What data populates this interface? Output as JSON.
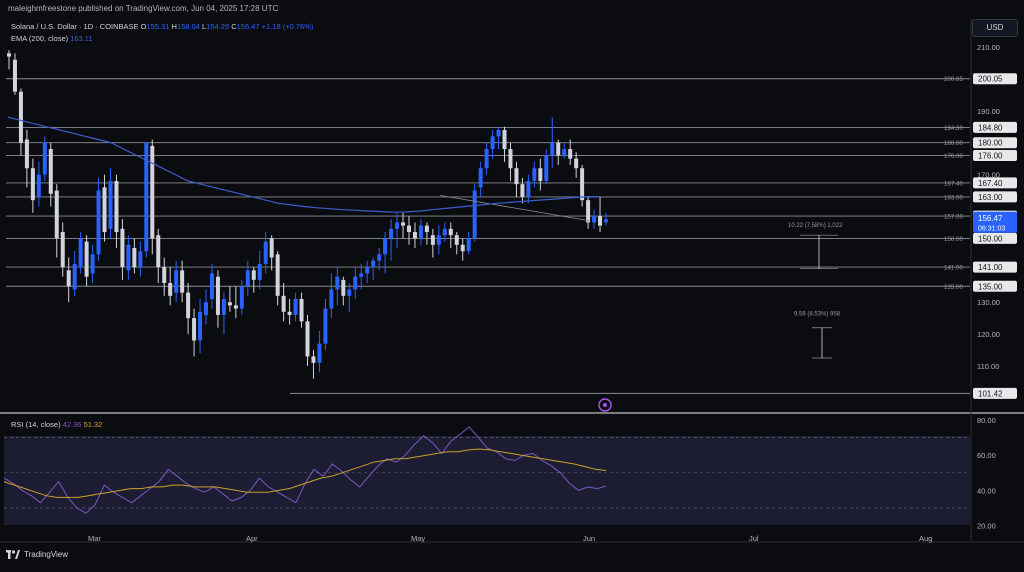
{
  "header": {
    "publisher_text": "maleighmfreestone published on TradingView.com, Jun 04, 2025 17:28 UTC"
  },
  "legend": {
    "symbol_title": "Solana / U.S. Dollar · 1D · COINBASE",
    "ohlc": [
      {
        "key": "O",
        "value": "155.31"
      },
      {
        "key": "H",
        "value": "158.04"
      },
      {
        "key": "L",
        "value": "154.29"
      },
      {
        "key": "C",
        "value": "156.47"
      }
    ],
    "change": "+1.18 (+0.76%)",
    "ema_label": "EMA (200, close)",
    "ema_value": "163.11"
  },
  "currency_button": "USD",
  "price_axis": {
    "ticks": [
      "210.00",
      "190.00",
      "170.00",
      "130.00",
      "120.00",
      "110.00"
    ]
  },
  "levels": [
    {
      "price": 200.05,
      "left_label": "200.05",
      "badge": "200.05"
    },
    {
      "price": 184.8,
      "left_label": "184.80",
      "badge": "184.80"
    },
    {
      "price": 180.0,
      "left_label": "180.00",
      "badge": "180.00"
    },
    {
      "price": 176.0,
      "left_label": "176.00",
      "badge": "176.00"
    },
    {
      "price": 167.4,
      "left_label": "167.40",
      "badge": "167.40"
    },
    {
      "price": 163.0,
      "left_label": "163.00",
      "badge": "163.00"
    },
    {
      "price": 157.0,
      "left_label": "157.00",
      "badge": "157.00"
    },
    {
      "price": 150.0,
      "left_label": "150.00",
      "badge": "150.00"
    },
    {
      "price": 141.0,
      "left_label": "141.00",
      "badge": "141.00"
    },
    {
      "price": 135.0,
      "left_label": "135.00",
      "badge": "135.00"
    },
    {
      "price": 101.42,
      "left_label": "",
      "badge": "101.42"
    }
  ],
  "current_price": {
    "price": 156.47,
    "value": "156.47",
    "countdown": "06:31:03",
    "color": "#2962ff"
  },
  "measurements": [
    {
      "label": "10.22 (7.58%) 1,022"
    },
    {
      "label": "9.58 (8.53%) 958"
    }
  ],
  "rsi": {
    "label": "RSI (14, close)",
    "value": "42.36",
    "ma_value": "51.32",
    "ticks": [
      "80.00",
      "60.00",
      "40.00",
      "20.00"
    ]
  },
  "time_axis": [
    "Mar",
    "Apr",
    "May",
    "Jun",
    "Jul",
    "Aug"
  ],
  "footer_brand": "TradingView",
  "colors": {
    "background": "#0b0c10",
    "up_candle": "#2962ff",
    "down_candle": "#d1d4dc",
    "ema": "#3f5bd1",
    "rsi_line": "#7e57c2",
    "rsi_ma": "#c9a227",
    "level_line": "#8a8d96"
  },
  "chart_data": {
    "type": "candlestick",
    "price_scale": [
      95,
      225
    ],
    "candles": [
      [
        208,
        207,
        209,
        203
      ],
      [
        206,
        196,
        208,
        195
      ],
      [
        196,
        180,
        197,
        176
      ],
      [
        181,
        172,
        184,
        166
      ],
      [
        172,
        162,
        175,
        158
      ],
      [
        163,
        170,
        174,
        160
      ],
      [
        170,
        180,
        182,
        168
      ],
      [
        178,
        164,
        180,
        160
      ],
      [
        165,
        150,
        167,
        144
      ],
      [
        152,
        141,
        155,
        138
      ],
      [
        140,
        135,
        144,
        130
      ],
      [
        134,
        142,
        146,
        132
      ],
      [
        141,
        150,
        152,
        139
      ],
      [
        149,
        138,
        151,
        135
      ],
      [
        139,
        145,
        148,
        136
      ],
      [
        145,
        165,
        169,
        143
      ],
      [
        166,
        152,
        170,
        149
      ],
      [
        153,
        168,
        172,
        150
      ],
      [
        168,
        152,
        170,
        147
      ],
      [
        153,
        141,
        156,
        137
      ],
      [
        140,
        148,
        151,
        137
      ],
      [
        147,
        141,
        150,
        139
      ],
      [
        141,
        146,
        149,
        138
      ],
      [
        146,
        180,
        180,
        144
      ],
      [
        179,
        150,
        181,
        145
      ],
      [
        151,
        141,
        153,
        136
      ],
      [
        141,
        136,
        144,
        132
      ],
      [
        136,
        132,
        141,
        129
      ],
      [
        133,
        140,
        143,
        130
      ],
      [
        140,
        133,
        143,
        130
      ],
      [
        133,
        125,
        136,
        120
      ],
      [
        125,
        118,
        128,
        113
      ],
      [
        118,
        127,
        131,
        114
      ],
      [
        126,
        130,
        134,
        123
      ],
      [
        131,
        139,
        142,
        128
      ],
      [
        138,
        126,
        140,
        122
      ],
      [
        126,
        131,
        133,
        120
      ],
      [
        130,
        129,
        135,
        127
      ],
      [
        129,
        128,
        135,
        125
      ],
      [
        128,
        135,
        137,
        126
      ],
      [
        135,
        140,
        143,
        132
      ],
      [
        140,
        137,
        141,
        133
      ],
      [
        137,
        142,
        146,
        134
      ],
      [
        142,
        149,
        152,
        139
      ],
      [
        150,
        144,
        151,
        140
      ],
      [
        145,
        132,
        146,
        129
      ],
      [
        132,
        127,
        136,
        124
      ],
      [
        127,
        126,
        131,
        123
      ],
      [
        126,
        131,
        133,
        124
      ],
      [
        131,
        124,
        133,
        122
      ],
      [
        124,
        113,
        126,
        110
      ],
      [
        113,
        111,
        115,
        106
      ],
      [
        111,
        117,
        121,
        108
      ],
      [
        117,
        128,
        131,
        115
      ],
      [
        128,
        134,
        139,
        125
      ],
      [
        134,
        138,
        141,
        129
      ],
      [
        137,
        132,
        138,
        129
      ],
      [
        132,
        134,
        136,
        127
      ],
      [
        134,
        138,
        141,
        131
      ],
      [
        138,
        139,
        142,
        134
      ],
      [
        139,
        141,
        143,
        136
      ],
      [
        141,
        143,
        144,
        137
      ],
      [
        143,
        145,
        147,
        140
      ],
      [
        145,
        150,
        152,
        139
      ],
      [
        150,
        153,
        156,
        143
      ],
      [
        153,
        155,
        158,
        147
      ],
      [
        155,
        154,
        158,
        150
      ],
      [
        154,
        152,
        157,
        148
      ],
      [
        152,
        150,
        155,
        147
      ],
      [
        150,
        154,
        156,
        148
      ],
      [
        154,
        152,
        155,
        148
      ],
      [
        151,
        148,
        153,
        144
      ],
      [
        148,
        151,
        154,
        145
      ],
      [
        151,
        153,
        155,
        149
      ],
      [
        153,
        151,
        155,
        147
      ],
      [
        151,
        148,
        152,
        145
      ],
      [
        148,
        146,
        150,
        143
      ],
      [
        146,
        150,
        152,
        145
      ],
      [
        150,
        165,
        167,
        149
      ],
      [
        166,
        172,
        174,
        163
      ],
      [
        172,
        178,
        180,
        170
      ],
      [
        178,
        182,
        184,
        175
      ],
      [
        182,
        184,
        185,
        178
      ],
      [
        184,
        178,
        185,
        174
      ],
      [
        178,
        172,
        180,
        168
      ],
      [
        172,
        167,
        174,
        163
      ],
      [
        167,
        163,
        169,
        161
      ],
      [
        163,
        168,
        170,
        161
      ],
      [
        168,
        172,
        174,
        166
      ],
      [
        172,
        168,
        175,
        165
      ],
      [
        168,
        176,
        178,
        167
      ],
      [
        176,
        180,
        188,
        172
      ],
      [
        180,
        176,
        181,
        173
      ],
      [
        176,
        178,
        180,
        175
      ],
      [
        178,
        175,
        181,
        173
      ],
      [
        175,
        172,
        177,
        169
      ],
      [
        172,
        162,
        173,
        160
      ],
      [
        162,
        155,
        163,
        153
      ],
      [
        155,
        157,
        159,
        153
      ],
      [
        157,
        154,
        163,
        152
      ],
      [
        155,
        156,
        158,
        154
      ]
    ],
    "ema": [
      188,
      187,
      186,
      185,
      184,
      183,
      182,
      181,
      180,
      178,
      176,
      174,
      172,
      170,
      168,
      167,
      166,
      165,
      164,
      163,
      162,
      161,
      160.5,
      160,
      159.6,
      159.3,
      159,
      158.8,
      158.6,
      158.4,
      158.2,
      158.3,
      158.6,
      159,
      159.4,
      159.8,
      160.2,
      160.6,
      161,
      161.3,
      161.6,
      161.9,
      162.2,
      162.5,
      162.8,
      163.1,
      163.11
    ],
    "rsi": [
      47,
      44,
      40,
      37,
      33,
      39,
      45,
      36,
      30,
      27,
      32,
      43,
      39,
      36,
      33,
      37,
      41,
      45,
      52,
      48,
      44,
      41,
      39,
      42,
      38,
      34,
      36,
      40,
      47,
      42,
      39,
      36,
      33,
      44,
      52,
      48,
      55,
      51,
      46,
      42,
      48,
      54,
      58,
      56,
      60,
      66,
      71,
      67,
      61,
      68,
      72,
      76,
      70,
      64,
      62,
      58,
      57,
      60,
      61,
      57,
      54,
      50,
      44,
      40,
      42,
      41,
      42.36
    ],
    "rsi_ma": [
      45,
      43,
      41,
      39,
      37,
      36,
      36,
      36,
      37,
      38,
      39,
      40,
      41,
      41,
      42,
      42,
      43,
      43,
      42,
      42,
      42,
      41,
      40,
      39,
      39,
      39,
      40,
      41,
      43,
      45,
      47,
      48,
      50,
      52,
      54,
      56,
      57,
      58,
      58,
      59,
      60,
      61,
      62,
      62,
      63,
      63.5,
      63,
      62,
      61,
      60,
      59,
      58,
      57,
      56,
      55,
      53.5,
      52,
      51.32
    ]
  }
}
